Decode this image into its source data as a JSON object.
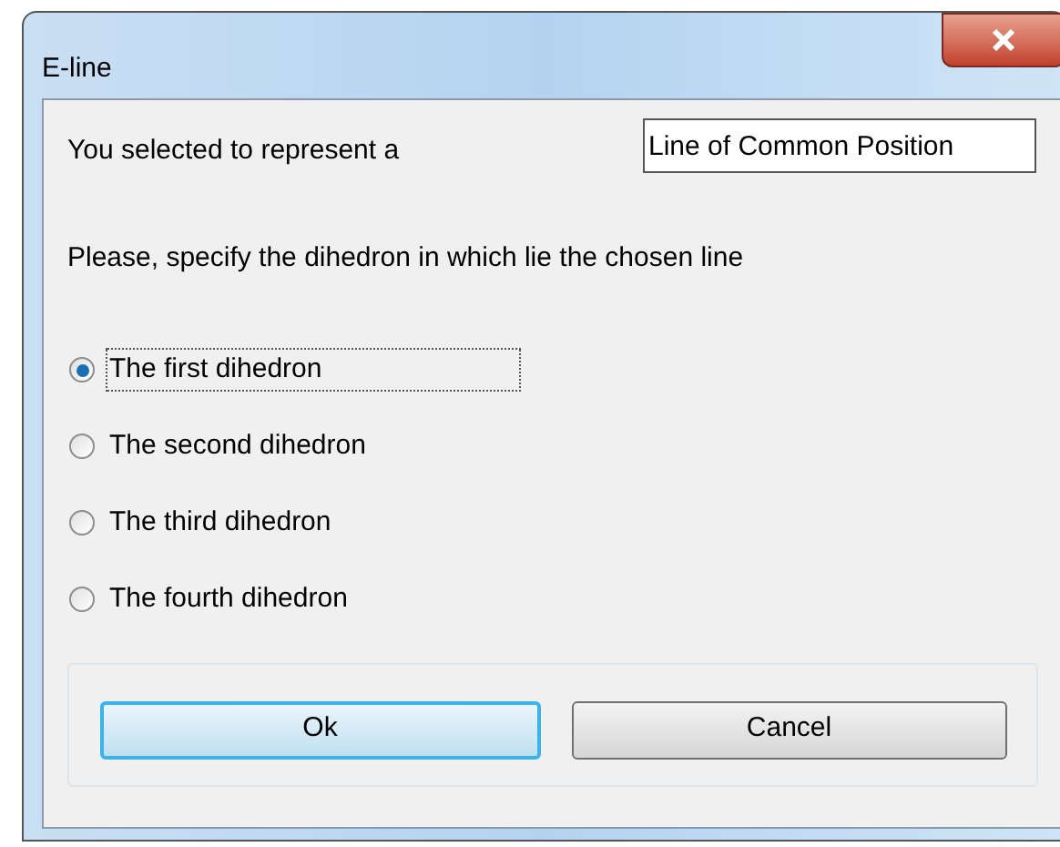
{
  "window": {
    "title": "E-line"
  },
  "prompt": "You selected to represent a",
  "line_type": {
    "value": "Line of Common Position"
  },
  "instruction": "Please, specify the dihedron in which lie the chosen line",
  "options": [
    {
      "label": "The first dihedron",
      "selected": true
    },
    {
      "label": "The second dihedron",
      "selected": false
    },
    {
      "label": "The third dihedron",
      "selected": false
    },
    {
      "label": "The fourth dihedron",
      "selected": false
    }
  ],
  "buttons": [
    {
      "label": "Ok",
      "default": true
    },
    {
      "label": "Cancel",
      "default": false
    }
  ]
}
